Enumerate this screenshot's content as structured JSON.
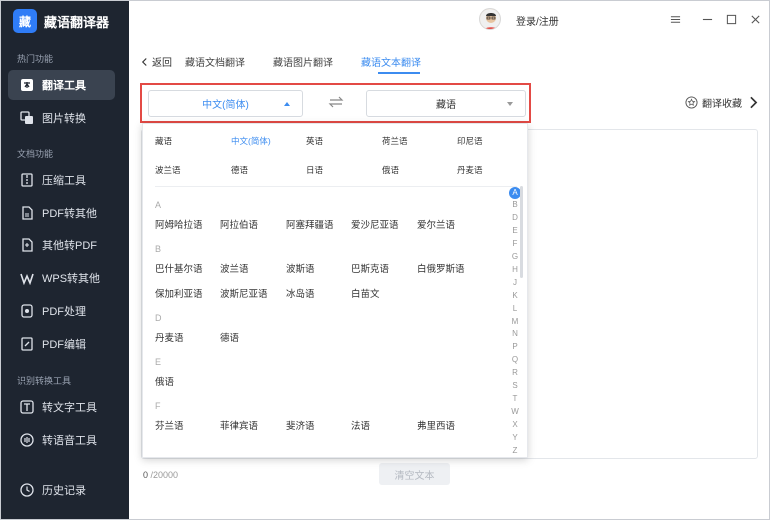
{
  "app": {
    "logo_text": "藏",
    "name": "藏语翻译器"
  },
  "window": {
    "login_label": "登录/注册"
  },
  "sidebar": {
    "section_hot": "热门功能",
    "section_doc": "文档功能",
    "section_ocr": "识别转换工具",
    "items": [
      {
        "label": "翻译工具",
        "icon": "translate-icon"
      },
      {
        "label": "图片转换",
        "icon": "image-convert-icon"
      },
      {
        "label": "压缩工具",
        "icon": "compress-icon"
      },
      {
        "label": "PDF转其他",
        "icon": "pdf-icon"
      },
      {
        "label": "其他转PDF",
        "icon": "to-pdf-icon"
      },
      {
        "label": "WPS转其他",
        "icon": "wps-icon"
      },
      {
        "label": "PDF处理",
        "icon": "pdf-process-icon"
      },
      {
        "label": "PDF编辑",
        "icon": "pdf-edit-icon"
      },
      {
        "label": "转文字工具",
        "icon": "text-convert-icon"
      },
      {
        "label": "转语音工具",
        "icon": "voice-icon"
      }
    ],
    "history": "历史记录"
  },
  "tabs": {
    "back": "返回",
    "items": [
      "藏语文档翻译",
      "藏语图片翻译",
      "藏语文本翻译"
    ]
  },
  "selector": {
    "source": "中文(简体)",
    "target": "藏语",
    "favorite": "翻译收藏"
  },
  "dropdown": {
    "quick": [
      "藏语",
      "中文(简体)",
      "英语",
      "荷兰语",
      "印尼语",
      "波兰语",
      "德语",
      "日语",
      "俄语",
      "丹麦语"
    ],
    "groups": [
      {
        "letter": "A",
        "langs": [
          "阿姆哈拉语",
          "阿拉伯语",
          "阿塞拜疆语",
          "爱沙尼亚语",
          "爱尔兰语"
        ]
      },
      {
        "letter": "B",
        "langs": [
          "巴什基尔语",
          "波兰语",
          "波斯语",
          "巴斯克语",
          "白俄罗斯语",
          "保加利亚语",
          "波斯尼亚语",
          "冰岛语",
          "白苗文"
        ]
      },
      {
        "letter": "D",
        "langs": [
          "丹麦语",
          "德语"
        ]
      },
      {
        "letter": "E",
        "langs": [
          "俄语"
        ]
      },
      {
        "letter": "F",
        "langs": [
          "芬兰语",
          "菲律宾语",
          "斐济语",
          "法语",
          "弗里西语"
        ]
      }
    ],
    "alphabet": [
      "A",
      "B",
      "D",
      "E",
      "F",
      "G",
      "H",
      "J",
      "K",
      "L",
      "M",
      "N",
      "P",
      "Q",
      "R",
      "S",
      "T",
      "W",
      "X",
      "Y",
      "Z"
    ]
  },
  "footer": {
    "count": "0",
    "max": "/20000",
    "clear": "清空文本"
  }
}
